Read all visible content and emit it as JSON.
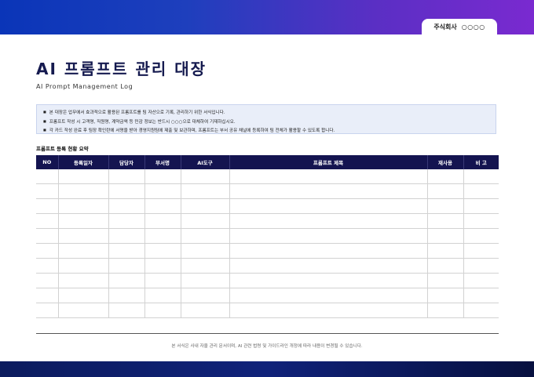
{
  "header": {
    "company_label": "주식회사",
    "company_code": "○○○○"
  },
  "title": "AI 프롬프트 관리 대장",
  "subtitle": "AI Prompt Management Log",
  "notice": [
    "본 대장은 업무에서 효과적으로 활용된 프롬프트를 팀 자산으로 기록, 관리하기 위한 서식입니다.",
    "프롬프트 작성 시 고객명, 직원명, 계약금액 등 민감 정보는 반드시 ○○○으로 대체하여 기재하십시오.",
    "각 카드 작성 완료 후 팀장 확인란에 서명을 받아 경영지원팀에 제출 및 보관하며, 프롬프트는 부서 공유 채널에 등록하여 팀 전체가 활용할 수 있도록 합니다."
  ],
  "section_title": "프롬프트 등록 현황 요약",
  "table": {
    "columns": [
      "NO",
      "등록일자",
      "담당자",
      "부서명",
      "AI도구",
      "프롬프트 제목",
      "재사용",
      "비 고"
    ],
    "empty_rows": 10
  },
  "footnote": "본 서식은 사내 자율 관리 문서이며, AI 관련 법령 및 가이드라인 개정에 따라 내용이 변경될 수 있습니다.",
  "colors": {
    "header_gradient_start": "#0a35b8",
    "header_gradient_end": "#7a2ad0",
    "title_color": "#151a4f",
    "table_header_bg": "#141450",
    "notice_bg": "#e9eef9",
    "footer_bg": "#0c1c5e"
  }
}
